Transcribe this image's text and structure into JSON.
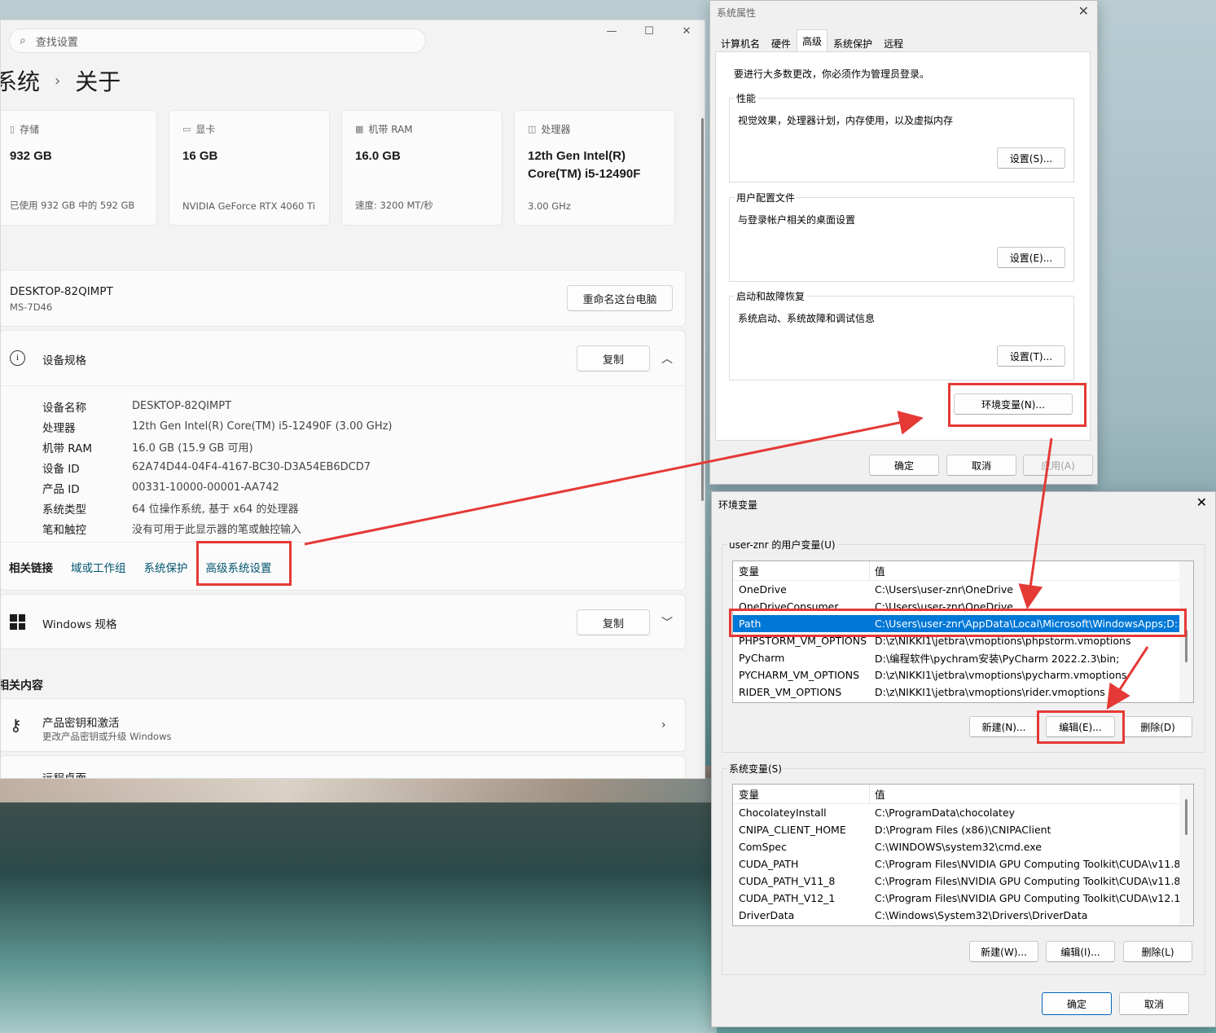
{
  "settings": {
    "search_placeholder": "查找设置",
    "window_controls": {
      "minimize": "—",
      "maximize": "☐",
      "close": "✕"
    },
    "breadcrumb": {
      "parent": "系统",
      "separator": "›",
      "current": "关于"
    },
    "cards": [
      {
        "icon": "▯",
        "label": "存储",
        "value": "932 GB",
        "sub": "已使用 932 GB 中的 592 GB"
      },
      {
        "icon": "▭",
        "label": "显卡",
        "value": "16 GB",
        "sub": "NVIDIA GeForce RTX 4060 Ti"
      },
      {
        "icon": "▦",
        "label": "机带 RAM",
        "value": "16.0 GB",
        "sub": "速度: 3200 MT/秒"
      },
      {
        "icon": "◫",
        "label": "处理器",
        "value": "12th Gen Intel(R) Core(TM) i5-12490F",
        "sub": "3.00 GHz"
      }
    ],
    "pc": {
      "name": "DESKTOP-82QIMPT",
      "model": "MS-7D46",
      "rename_button": "重命名这台电脑"
    },
    "device_spec": {
      "title": "设备规格",
      "copy_button": "复制",
      "rows": [
        {
          "k": "设备名称",
          "v": "DESKTOP-82QIMPT"
        },
        {
          "k": "处理器",
          "v": "12th Gen Intel(R) Core(TM) i5-12490F (3.00 GHz)"
        },
        {
          "k": "机带 RAM",
          "v": "16.0 GB (15.9 GB 可用)"
        },
        {
          "k": "设备 ID",
          "v": "62A74D44-04F4-4167-BC30-D3A54EB6DCD7"
        },
        {
          "k": "产品 ID",
          "v": "00331-10000-00001-AA742"
        },
        {
          "k": "系统类型",
          "v": "64 位操作系统, 基于 x64 的处理器"
        },
        {
          "k": "笔和触控",
          "v": "没有可用于此显示器的笔或触控输入"
        }
      ]
    },
    "related_links": {
      "heading": "相关链接",
      "domain": "域或工作组",
      "protection": "系统保护",
      "advanced": "高级系统设置"
    },
    "windows_spec": {
      "title": "Windows 规格",
      "copy_button": "复制"
    },
    "related_content": "相关内容",
    "product_key": {
      "title": "产品密钥和激活",
      "sub": "更改产品密钥或升级 Windows"
    },
    "remote_desktop": "远程桌面"
  },
  "sysprops": {
    "title": "系统属性",
    "close": "✕",
    "tabs": [
      "计算机名",
      "硬件",
      "高级",
      "系统保护",
      "远程"
    ],
    "active_tab": "高级",
    "admin_note": "要进行大多数更改，你必须作为管理员登录。",
    "performance": {
      "label": "性能",
      "desc": "视觉效果，处理器计划，内存使用，以及虚拟内存",
      "button": "设置(S)..."
    },
    "user_profiles": {
      "label": "用户配置文件",
      "desc": "与登录帐户相关的桌面设置",
      "button": "设置(E)..."
    },
    "startup": {
      "label": "启动和故障恢复",
      "desc": "系统启动、系统故障和调试信息",
      "button": "设置(T)..."
    },
    "env_button": "环境变量(N)...",
    "ok": "确定",
    "cancel": "取消",
    "apply": "应用(A)"
  },
  "envvars": {
    "title": "环境变量",
    "close": "✕",
    "user_group_label": "user-znr 的用户变量(U)",
    "col_var": "变量",
    "col_val": "值",
    "user_vars": [
      {
        "name": "OneDrive",
        "value": "C:\\Users\\user-znr\\OneDrive"
      },
      {
        "name": "OneDriveConsumer",
        "value": "C:\\Users\\user-znr\\OneDrive"
      },
      {
        "name": "Path",
        "value": "C:\\Users\\user-znr\\AppData\\Local\\Microsoft\\WindowsApps;D:..."
      },
      {
        "name": "PHPSTORM_VM_OPTIONS",
        "value": "D:\\z\\NIKKI1\\jetbra\\vmoptions\\phpstorm.vmoptions"
      },
      {
        "name": "PyCharm",
        "value": "D:\\编程软件\\pychram安装\\PyCharm 2022.2.3\\bin;"
      },
      {
        "name": "PYCHARM_VM_OPTIONS",
        "value": "D:\\z\\NIKKI1\\jetbra\\vmoptions\\pycharm.vmoptions"
      },
      {
        "name": "RIDER_VM_OPTIONS",
        "value": "D:\\z\\NIKKI1\\jetbra\\vmoptions\\rider.vmoptions"
      }
    ],
    "selected_user_var": "Path",
    "user_buttons": {
      "new": "新建(N)...",
      "edit": "编辑(E)...",
      "delete": "删除(D)"
    },
    "system_group_label": "系统变量(S)",
    "system_vars": [
      {
        "name": "ChocolateyInstall",
        "value": "C:\\ProgramData\\chocolatey"
      },
      {
        "name": "CNIPA_CLIENT_HOME",
        "value": "D:\\Program Files (x86)\\CNIPAClient"
      },
      {
        "name": "ComSpec",
        "value": "C:\\WINDOWS\\system32\\cmd.exe"
      },
      {
        "name": "CUDA_PATH",
        "value": "C:\\Program Files\\NVIDIA GPU Computing Toolkit\\CUDA\\v11.8"
      },
      {
        "name": "CUDA_PATH_V11_8",
        "value": "C:\\Program Files\\NVIDIA GPU Computing Toolkit\\CUDA\\v11.8"
      },
      {
        "name": "CUDA_PATH_V12_1",
        "value": "C:\\Program Files\\NVIDIA GPU Computing Toolkit\\CUDA\\v12.1"
      },
      {
        "name": "DriverData",
        "value": "C:\\Windows\\System32\\Drivers\\DriverData"
      }
    ],
    "system_buttons": {
      "new": "新建(W)...",
      "edit": "编辑(I)...",
      "delete": "删除(L)"
    },
    "ok": "确定",
    "cancel": "取消"
  },
  "annotation_color": "#e53935"
}
